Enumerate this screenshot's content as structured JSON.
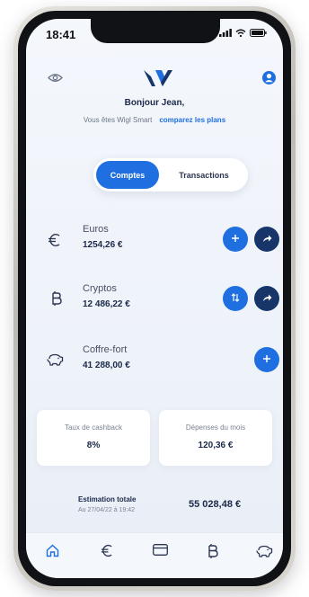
{
  "status_bar": {
    "time": "18:41"
  },
  "header": {
    "eye_icon": "eye-icon",
    "logo_icon": "wigl-logo-icon",
    "profile_icon": "user-icon",
    "greeting": "Bonjour Jean,",
    "subtitle": "Vous êtes Wigl Smart",
    "compare_link": "comparez les plans"
  },
  "tabs": {
    "active": "Comptes",
    "other": "Transactions"
  },
  "accounts": [
    {
      "name": "Euros",
      "value": "1254,26 €",
      "icon": "euro-icon"
    },
    {
      "name": "Cryptos",
      "value": "12 486,22 €",
      "icon": "bitcoin-icon"
    },
    {
      "name": "Coffre-fort",
      "value": "41 288,00 €",
      "icon": "piggy-bank-icon"
    }
  ],
  "cards": [
    {
      "label": "Taux de cashback",
      "value": "8%"
    },
    {
      "label": "Dépenses du mois",
      "value": "120,36 €"
    }
  ],
  "total": {
    "label": "Estimation totale",
    "date": "Au 27/04/22 à 19:42",
    "value": "55 028,48 €"
  },
  "tabbar": [
    "home-icon",
    "euro-icon",
    "card-icon",
    "bitcoin-icon",
    "piggy-bank-icon"
  ],
  "colors": {
    "accent": "#1f6fe0",
    "navy": "#173568",
    "text": "#1b2a4a"
  }
}
